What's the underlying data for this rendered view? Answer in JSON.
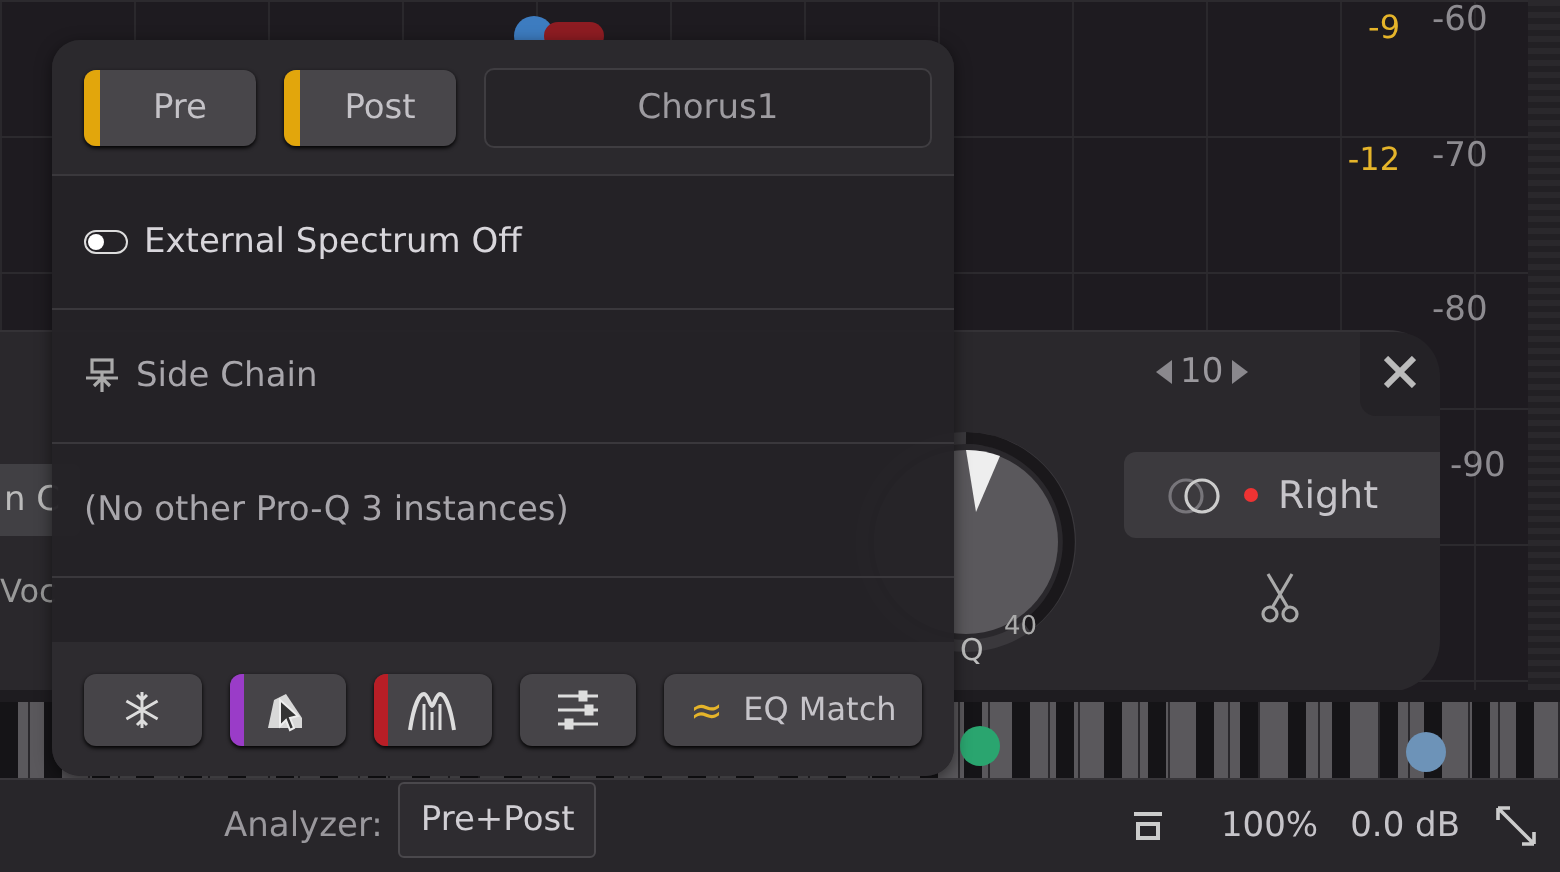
{
  "popup": {
    "source_buttons": [
      {
        "label": "Pre",
        "on": true
      },
      {
        "label": "Post",
        "on": true
      }
    ],
    "instance_name": "Chorus1",
    "external_spectrum": {
      "label": "External Spectrum Off",
      "on": false
    },
    "side_chain": "Side Chain",
    "instances_note": "(No other Pro-Q 3 instances)",
    "toolbar": [
      {
        "kind": "freeze"
      },
      {
        "kind": "collision",
        "color": "#9a3cc8"
      },
      {
        "kind": "spectrum",
        "color": "#b81e26"
      },
      {
        "kind": "settings"
      },
      {
        "kind": "eq-match",
        "symbol": "≈",
        "label": "EQ Match"
      }
    ]
  },
  "scale": {
    "gain_labels": [
      "-9",
      "-12"
    ],
    "db_labels": [
      "-60",
      "-70",
      "-80",
      "-90"
    ]
  },
  "band_panel": {
    "left_labels": [
      "n C",
      "Voc"
    ],
    "band_number": "10",
    "q_label": "Q",
    "q_value": "40",
    "channel": "Right"
  },
  "bottom_bar": {
    "analyzer_label": "Analyzer:",
    "analyzer_value": "Pre+Post",
    "zoom": "100%",
    "gain": "0.0 dB"
  }
}
